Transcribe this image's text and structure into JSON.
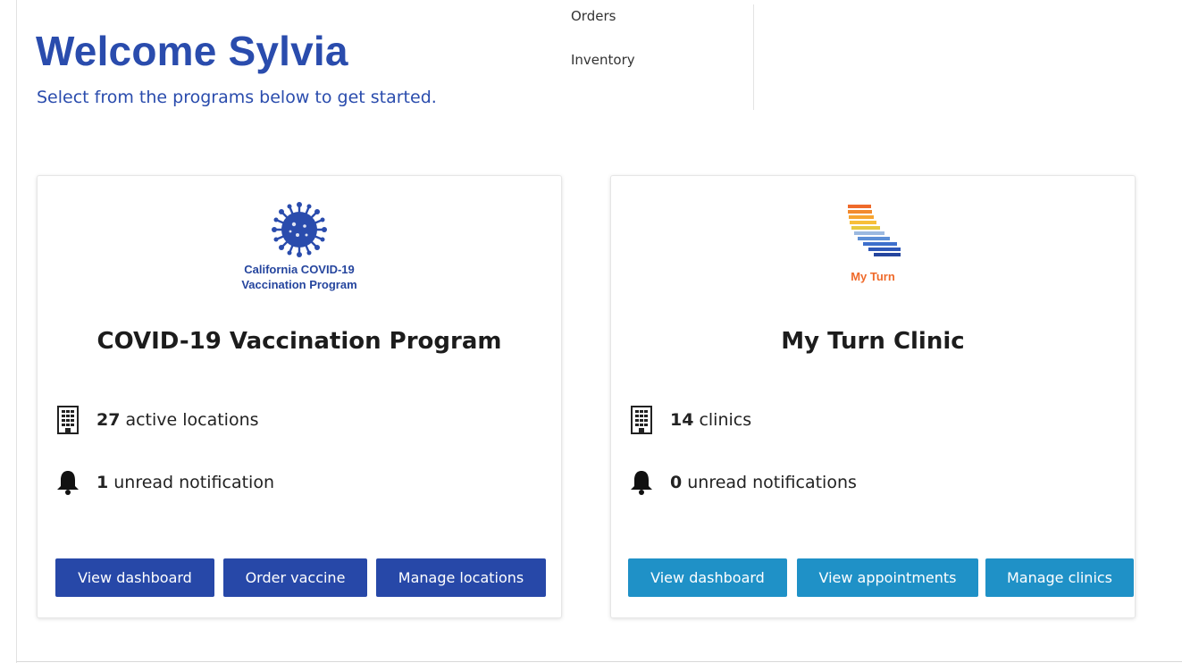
{
  "header": {
    "welcome": "Welcome Sylvia",
    "subtitle": "Select from the programs below to get started."
  },
  "top_menu": {
    "items": [
      "Orders",
      "Inventory"
    ]
  },
  "cards": [
    {
      "logo_icon": "virus-icon",
      "logo_caption_line1": "California COVID-19",
      "logo_caption_line2": "Vaccination Program",
      "title": "COVID-19 Vaccination Program",
      "locations_count": "27",
      "locations_label": "active locations",
      "notifications_count": "1",
      "notifications_label": "unread notification",
      "buttons": [
        "View dashboard",
        "Order vaccine",
        "Manage locations"
      ],
      "button_color": "#2748a8"
    },
    {
      "logo_icon": "california-map-icon",
      "logo_caption": "My Turn",
      "title": "My Turn Clinic",
      "locations_count": "14",
      "locations_label": "clinics",
      "notifications_count": "0",
      "notifications_label": "unread notifications",
      "buttons": [
        "View dashboard",
        "View appointments",
        "Manage clinics"
      ],
      "button_color": "#1f91c7"
    }
  ],
  "colors": {
    "brand_blue": "#2a4cad",
    "accent_orange": "#ef6a2a"
  }
}
